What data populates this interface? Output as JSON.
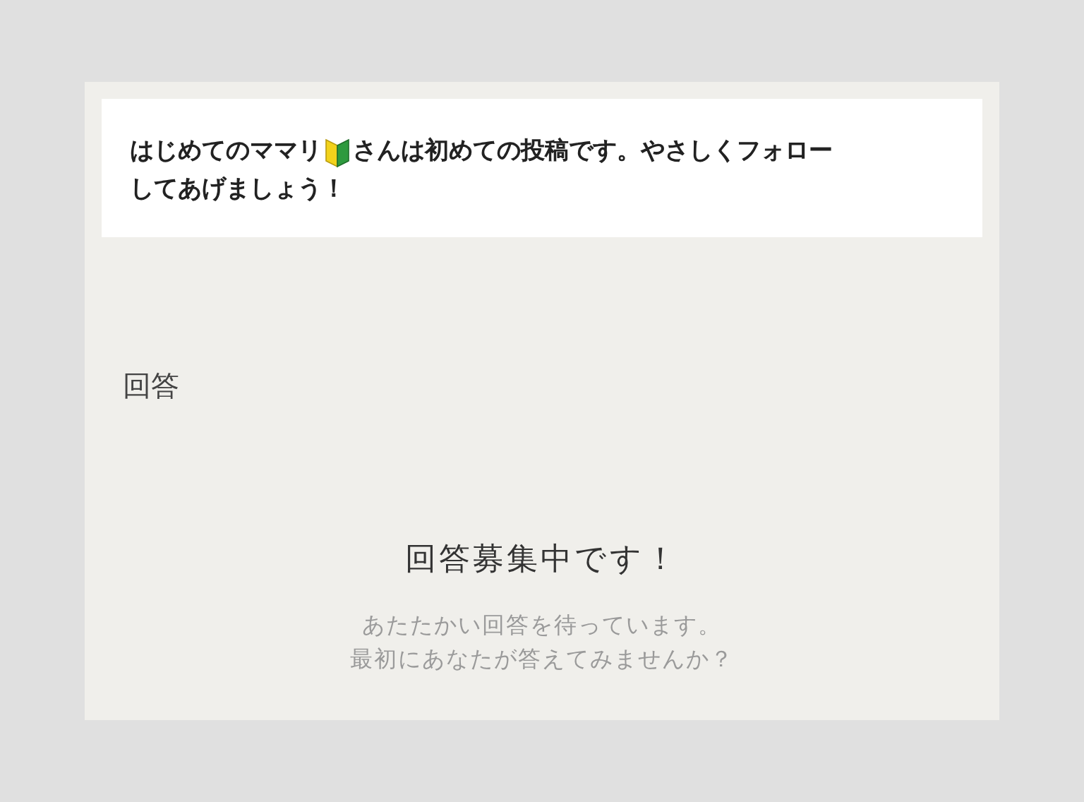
{
  "notice": {
    "user_name": "はじめてのママリ",
    "message_lines": [
      "さんは初めての投稿です。やさしくフォロー",
      "してあげましょう！"
    ]
  },
  "answers": {
    "heading": "回答",
    "empty_title": "回答募集中です！",
    "empty_lines": [
      "あたたかい回答を待っています。",
      "最初にあなたが答えてみませんか？"
    ]
  }
}
